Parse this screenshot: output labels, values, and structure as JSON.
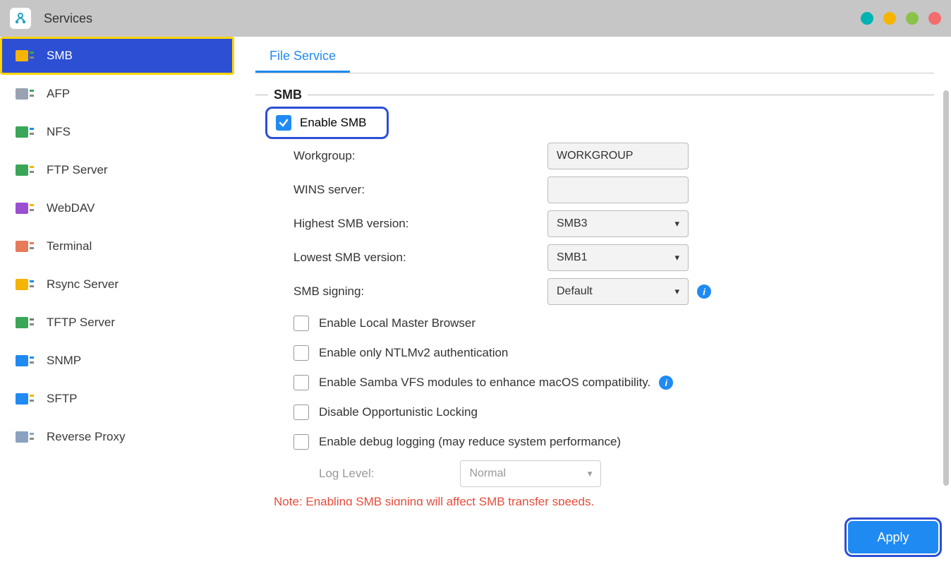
{
  "window": {
    "title": "Services"
  },
  "title_dots": [
    "#00b3b3",
    "#f5b400",
    "#8bc34a",
    "#f26d6d"
  ],
  "sidebar": {
    "items": [
      {
        "label": "SMB",
        "active": true,
        "icon_fill": "#f5b400",
        "icon_stripe": "#3aa657"
      },
      {
        "label": "AFP",
        "active": false,
        "icon_fill": "#9aa2b1",
        "icon_stripe": "#3aa657"
      },
      {
        "label": "NFS",
        "active": false,
        "icon_fill": "#3aa657",
        "icon_stripe": "#1f8af2"
      },
      {
        "label": "FTP Server",
        "active": false,
        "icon_fill": "#3aa657",
        "icon_stripe": "#f5b400"
      },
      {
        "label": "WebDAV",
        "active": false,
        "icon_fill": "#9a4fd3",
        "icon_stripe": "#f5b400"
      },
      {
        "label": "Terminal",
        "active": false,
        "icon_fill": "#e67b5a",
        "icon_stripe": "#e67b5a"
      },
      {
        "label": "Rsync Server",
        "active": false,
        "icon_fill": "#f5b400",
        "icon_stripe": "#1f8af2"
      },
      {
        "label": "TFTP Server",
        "active": false,
        "icon_fill": "#3aa657",
        "icon_stripe": "#777777"
      },
      {
        "label": "SNMP",
        "active": false,
        "icon_fill": "#1f8af2",
        "icon_stripe": "#1f8af2"
      },
      {
        "label": "SFTP",
        "active": false,
        "icon_fill": "#1f8af2",
        "icon_stripe": "#f5b400"
      },
      {
        "label": "Reverse Proxy",
        "active": false,
        "icon_fill": "#8aa2c0",
        "icon_stripe": "#8aa2c0"
      }
    ]
  },
  "tabs": [
    {
      "label": "File Service",
      "active": true
    }
  ],
  "section": {
    "title": "SMB"
  },
  "form": {
    "enable_smb": {
      "label": "Enable SMB",
      "checked": true
    },
    "workgroup": {
      "label": "Workgroup:",
      "value": "WORKGROUP"
    },
    "wins": {
      "label": "WINS server:",
      "value": ""
    },
    "highest": {
      "label": "Highest SMB version:",
      "value": "SMB3"
    },
    "lowest": {
      "label": "Lowest SMB version:",
      "value": "SMB1"
    },
    "signing": {
      "label": "SMB signing:",
      "value": "Default"
    },
    "options": [
      {
        "label": "Enable Local Master Browser",
        "checked": false,
        "info": false
      },
      {
        "label": "Enable only NTLMv2 authentication",
        "checked": false,
        "info": false
      },
      {
        "label": "Enable Samba VFS modules to enhance macOS compatibility.",
        "checked": false,
        "info": true
      },
      {
        "label": "Disable Opportunistic Locking",
        "checked": false,
        "info": false
      },
      {
        "label": "Enable debug logging (may reduce system performance)",
        "checked": false,
        "info": false
      }
    ],
    "log_level": {
      "label": "Log Level:",
      "value": "Normal"
    },
    "note": "Note: Enabling SMB signing will affect SMB transfer speeds."
  },
  "footer": {
    "apply_label": "Apply"
  }
}
